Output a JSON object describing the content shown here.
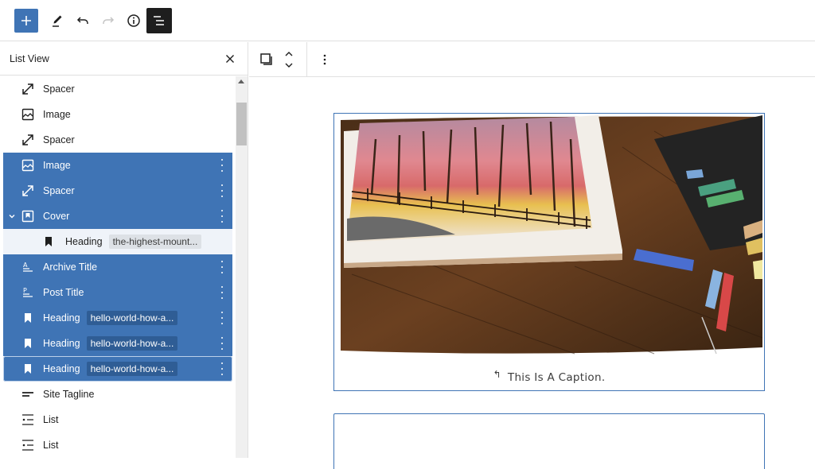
{
  "toolbar": {
    "add_label": "+",
    "items": [
      "add-block",
      "tools",
      "undo",
      "redo",
      "details",
      "list-view"
    ]
  },
  "sidebar": {
    "title": "List View",
    "close_label": "×",
    "rows": [
      {
        "label": "Spacer",
        "icon": "spacer-icon",
        "state": "normal",
        "badge": null
      },
      {
        "label": "Image",
        "icon": "image-icon",
        "state": "normal",
        "badge": null
      },
      {
        "label": "Spacer",
        "icon": "spacer-icon",
        "state": "normal",
        "badge": null
      },
      {
        "label": "Image",
        "icon": "image-icon",
        "state": "selected",
        "badge": null
      },
      {
        "label": "Spacer",
        "icon": "spacer-icon",
        "state": "selected",
        "badge": null
      },
      {
        "label": "Cover",
        "icon": "cover-icon",
        "state": "selected",
        "badge": null,
        "expanded": true
      },
      {
        "label": "Heading",
        "icon": "bookmark-icon",
        "state": "child",
        "badge": "the-highest-mount..."
      },
      {
        "label": "Archive Title",
        "icon": "archive-title-icon",
        "state": "selected",
        "badge": null
      },
      {
        "label": "Post Title",
        "icon": "post-title-icon",
        "state": "selected",
        "badge": null
      },
      {
        "label": "Heading",
        "icon": "bookmark-icon",
        "state": "selected",
        "badge": "hello-world-how-a..."
      },
      {
        "label": "Heading",
        "icon": "bookmark-icon",
        "state": "selected",
        "badge": "hello-world-how-a..."
      },
      {
        "label": "Heading",
        "icon": "bookmark-icon",
        "state": "selected-focus",
        "badge": "hello-world-how-a..."
      },
      {
        "label": "Site Tagline",
        "icon": "tagline-icon",
        "state": "normal",
        "badge": null
      },
      {
        "label": "List",
        "icon": "list-icon",
        "state": "normal",
        "badge": null
      },
      {
        "label": "List",
        "icon": "list-icon",
        "state": "normal",
        "badge": null
      }
    ]
  },
  "block_toolbar": {
    "items": [
      "block-type-icon",
      "move-up-down",
      "more-options"
    ]
  },
  "canvas": {
    "caption": "This Is A Caption.",
    "image_alt": "Pastel drawing of autumn trees and fence on a wooden table with pastel sticks"
  },
  "colors": {
    "accent": "#3f74b5",
    "selected_badge": "#2f5d95",
    "child_row": "#eff3f9",
    "dark": "#1e1e1e"
  }
}
